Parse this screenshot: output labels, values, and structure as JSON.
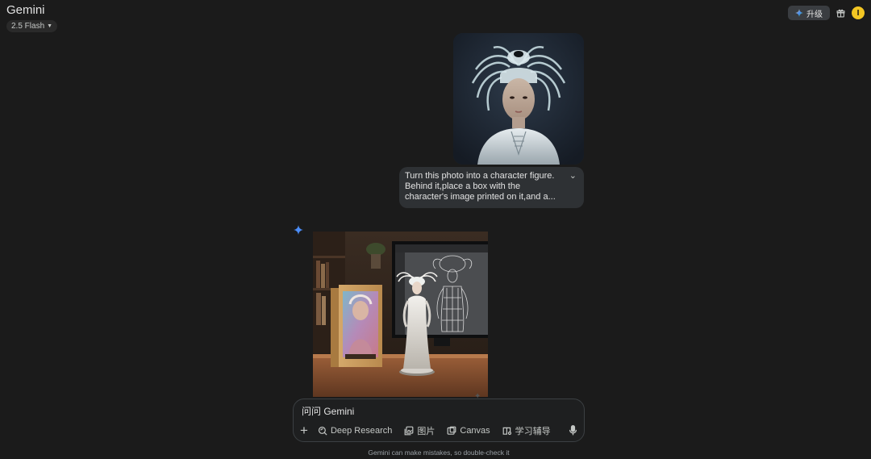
{
  "header": {
    "app_title": "Gemini",
    "model": "2.5 Flash",
    "upgrade_label": "升级",
    "avatar_initial": "I"
  },
  "conversation": {
    "user_prompt": "Turn this photo into a character figure.  Behind it,place a box with the character's image printed on it,and a...",
    "user_image": "portrait-woman-white-headdress",
    "response_image": "character-figure-with-box-and-monitor"
  },
  "input": {
    "placeholder": "问问 Gemini",
    "tools": [
      {
        "label": "Deep Research",
        "icon": "deep-research-icon"
      },
      {
        "label": "图片",
        "icon": "image-icon"
      },
      {
        "label": "Canvas",
        "icon": "canvas-icon"
      },
      {
        "label": "学习辅导",
        "icon": "guided-learning-icon"
      }
    ]
  },
  "footer": {
    "disclaimer": "Gemini can make mistakes, so double-check it"
  },
  "colors": {
    "background": "#1b1b1b",
    "bubble": "#2e3134",
    "accent_blue": "#4b8df8",
    "avatar": "#f3c623"
  }
}
